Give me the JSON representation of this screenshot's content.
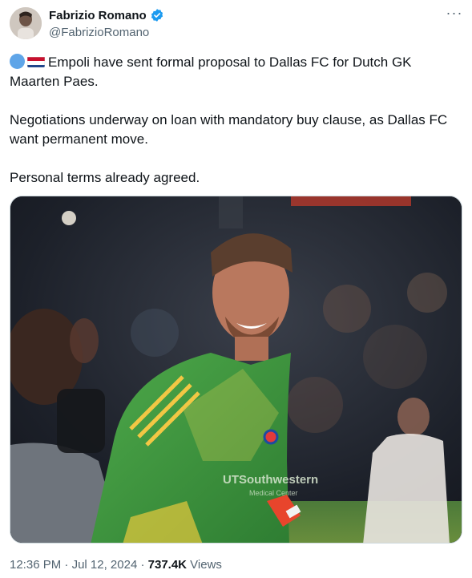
{
  "author": {
    "name": "Fabrizio Romano",
    "handle": "@FabrizioRomano",
    "verified_color": "#1d9bf0"
  },
  "more_button": "···",
  "tweet": {
    "paragraph1_main": "Empoli have sent formal proposal to Dallas FC for Dutch GK Maarten Paes.",
    "paragraph2": "Negotiations underway on loan with mandatory buy clause, as Dallas FC want permanent move.",
    "paragraph3": "Personal terms already agreed."
  },
  "media": {
    "jersey_sponsor": "UTSouthwestern",
    "jersey_sponsor_sub": "Medical Center"
  },
  "meta": {
    "time": "12:36 PM",
    "separator1": " · ",
    "date": "Jul 12, 2024",
    "separator2": " · ",
    "views_count": "737.4K",
    "views_label": " Views"
  }
}
